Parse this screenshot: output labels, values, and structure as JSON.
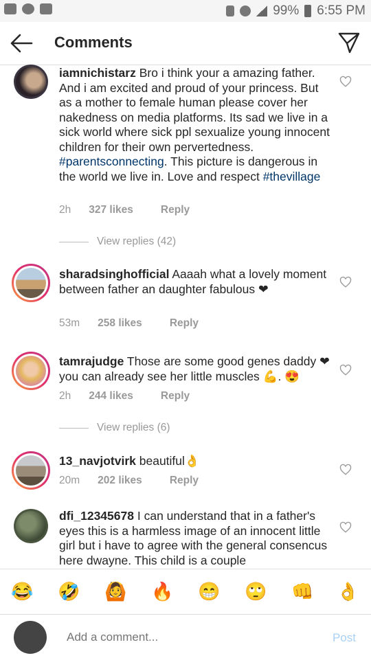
{
  "status": {
    "battery": "99%",
    "time": "6:55 PM"
  },
  "header": {
    "title": "Comments"
  },
  "comments": [
    {
      "user": "iamnichistarz",
      "text_a": "Bro i think your a amazing father. And i am excited and proud of your princess. But as a mother to female human please cover her nakedness on media platforms. Its sad we live in a sick world where sick ppl sexualize young innocent children for their own pervertedness. ",
      "tag1": "#parentsconnecting",
      "text_b": ". This picture is dangerous in the world we live in. Love and respect ",
      "tag2": "#thevillage",
      "time": "2h",
      "likes": "327 likes",
      "reply": "Reply",
      "view_replies": "View replies (42)"
    },
    {
      "user": "sharadsinghofficial",
      "text_a": "Aaaah what a lovely moment between father an daughter fabulous ❤",
      "time": "53m",
      "likes": "258 likes",
      "reply": "Reply"
    },
    {
      "user": "tamrajudge",
      "text_a": "Those are some good genes daddy ❤ you can already see her little muscles 💪. 😍",
      "time": "2h",
      "likes": "244 likes",
      "reply": "Reply",
      "view_replies": "View replies (6)"
    },
    {
      "user": "13_navjotvirk",
      "text_a": "beautiful👌",
      "time": "20m",
      "likes": "202 likes",
      "reply": "Reply"
    },
    {
      "user": "dfi_12345678",
      "text_a": "I can understand that in a father's eyes this is a harmless image of an innocent little girl but i have to agree with the general consencus here dwayne.  This child is a couple"
    }
  ],
  "emojis": [
    "😂",
    "🤣",
    "🙆",
    "🔥",
    "😁",
    "🙄",
    "👊",
    "👌"
  ],
  "composer": {
    "placeholder": "Add a comment...",
    "post": "Post"
  },
  "colors": {
    "hashtag": "#003569",
    "post_disabled": "#a8d1f5",
    "meta": "#999999"
  }
}
